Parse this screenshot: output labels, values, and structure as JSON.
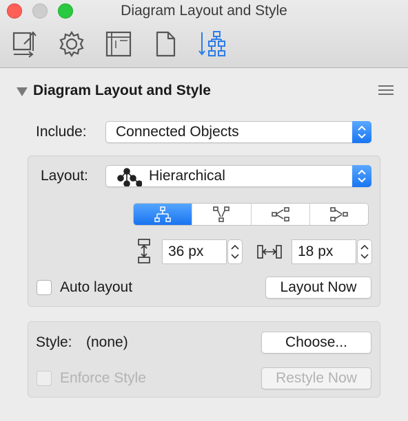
{
  "window": {
    "title": "Diagram Layout and Style"
  },
  "toolbar": {
    "icons": [
      "canvas-size-icon",
      "gear-icon",
      "canvas-icon",
      "document-icon",
      "diagram-layout-icon"
    ],
    "selected_index": 4,
    "accent": "#2b7de9"
  },
  "panel": {
    "title": "Diagram Layout and Style"
  },
  "include": {
    "label": "Include:",
    "value": "Connected Objects"
  },
  "layout": {
    "label": "Layout:",
    "value": "Hierarchical",
    "direction_options": [
      "top-to-bottom",
      "bottom-to-top",
      "left-to-right",
      "right-to-left"
    ],
    "direction_selected_index": 0,
    "vertical_spacing": "36 px",
    "horizontal_spacing": "18 px",
    "auto_layout_label": "Auto layout",
    "auto_layout_checked": false,
    "layout_now_label": "Layout Now"
  },
  "style": {
    "label": "Style:",
    "value": "(none)",
    "choose_label": "Choose...",
    "enforce_label": "Enforce Style",
    "enforce_checked": false,
    "restyle_label": "Restyle Now"
  },
  "colors": {
    "accent": "#1a74f0",
    "close": "#fe5f57",
    "zoom": "#2ac940"
  }
}
